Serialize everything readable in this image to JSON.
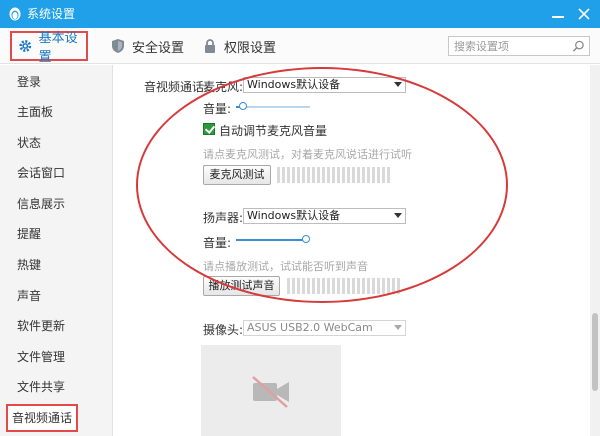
{
  "window": {
    "title": "系统设置",
    "minimize_icon": "minimize-icon",
    "close_icon": "close-icon"
  },
  "tabs": [
    {
      "label": "基本设置",
      "icon": "gear-icon",
      "active": true
    },
    {
      "label": "安全设置",
      "icon": "shield-icon",
      "active": false
    },
    {
      "label": "权限设置",
      "icon": "lock-icon",
      "active": false
    }
  ],
  "search": {
    "placeholder": "搜索设置项",
    "icon": "search-icon"
  },
  "sidebar": {
    "items": [
      {
        "label": "登录"
      },
      {
        "label": "主面板"
      },
      {
        "label": "状态"
      },
      {
        "label": "会话窗口"
      },
      {
        "label": "信息展示"
      },
      {
        "label": "提醒"
      },
      {
        "label": "热键"
      },
      {
        "label": "声音"
      },
      {
        "label": "软件更新"
      },
      {
        "label": "文件管理"
      },
      {
        "label": "文件共享"
      },
      {
        "label": "音视频通话",
        "active": true
      }
    ]
  },
  "av": {
    "section_label": "音视频通话:",
    "mic": {
      "label": "麦克风:",
      "device": "Windows默认设备",
      "volume_label": "音量:",
      "volume_level": 0.1,
      "auto_adjust_label": "自动调节麦克风音量",
      "auto_adjust_checked": true,
      "hint": "请点麦克风测试，对着麦克风说话进行试听",
      "test_button": "麦克风测试"
    },
    "speaker": {
      "label": "扬声器:",
      "device": "Windows默认设备",
      "volume_label": "音量:",
      "volume_level": 1.0,
      "hint": "请点播放测试，试试能否听到声音",
      "test_button": "播放测试声音"
    },
    "camera": {
      "label": "摄像头:",
      "device": "ASUS USB2.0 WebCam",
      "preview_icon": "camera-off-icon"
    }
  },
  "colors": {
    "titlebar": "#1fa0e8",
    "highlight_red": "#e34b4b",
    "active_tab_text": "#1a78c2",
    "checkbox_green": "#2b9a3a"
  }
}
